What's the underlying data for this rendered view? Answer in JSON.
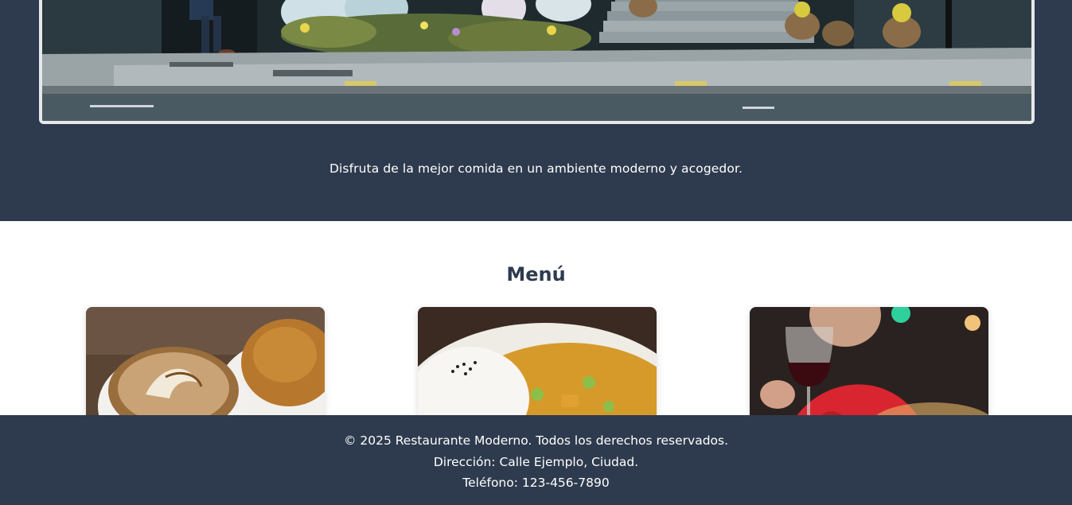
{
  "hero": {
    "image_icon": "restaurant-storefront-photo",
    "tagline": "Disfruta de la mejor comida en un ambiente moderno y acogedor."
  },
  "menu": {
    "title": "Menú",
    "items": [
      {
        "image_icon": "cappuccino-photo"
      },
      {
        "image_icon": "curry-rice-photo"
      },
      {
        "image_icon": "red-wine-photo"
      }
    ]
  },
  "footer": {
    "copyright": "© 2025 Restaurante Moderno. Todos los derechos reservados.",
    "address": "Dirección: Calle Ejemplo, Ciudad.",
    "phone": "Teléfono: 123-456-7890"
  },
  "colors": {
    "primary_dark": "#2e3b4e",
    "white": "#ffffff",
    "frame_border": "#e6e8ea"
  }
}
